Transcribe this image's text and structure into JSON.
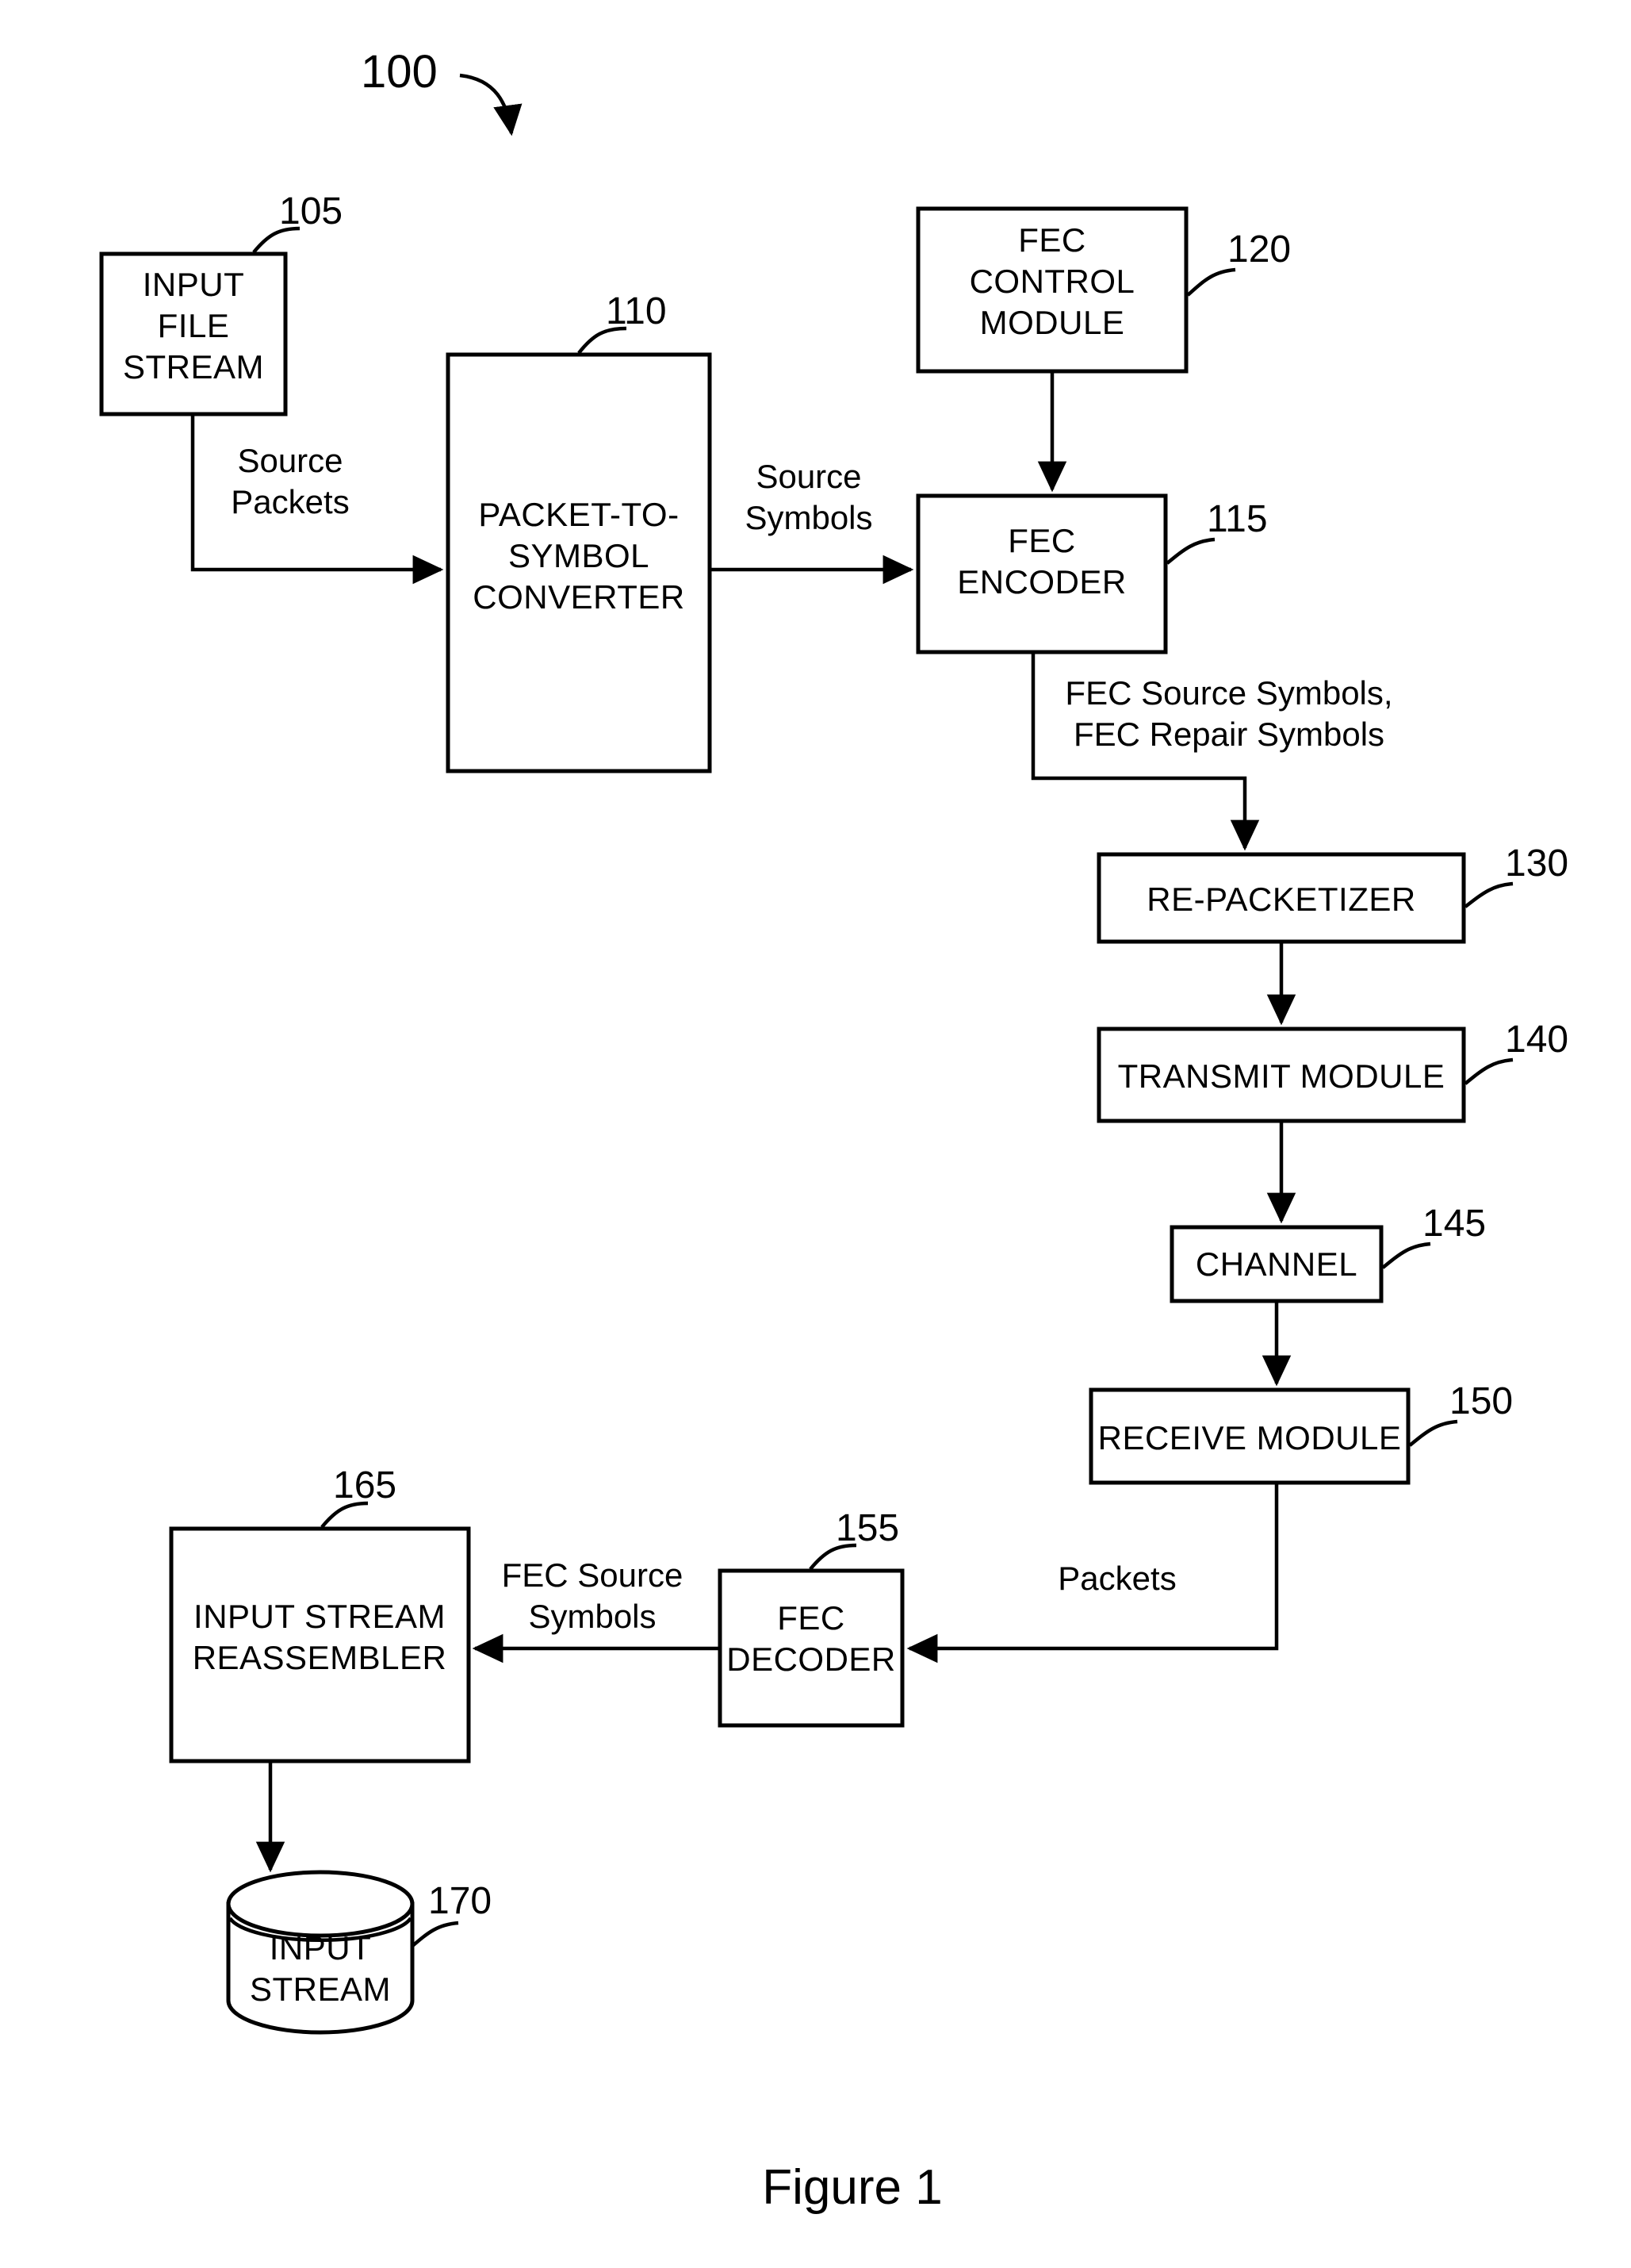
{
  "figure": {
    "caption": "Figure 1",
    "system_ref": "100"
  },
  "blocks": [
    {
      "id": "input-file-stream",
      "ref": "105",
      "lines": [
        "INPUT",
        "FILE",
        "STREAM"
      ]
    },
    {
      "id": "packet-to-symbol-converter",
      "ref": "110",
      "lines": [
        "PACKET-TO-",
        "SYMBOL",
        "CONVERTER"
      ]
    },
    {
      "id": "fec-control-module",
      "ref": "120",
      "lines": [
        "FEC",
        "CONTROL",
        "MODULE"
      ]
    },
    {
      "id": "fec-encoder",
      "ref": "115",
      "lines": [
        "FEC",
        "ENCODER"
      ]
    },
    {
      "id": "re-packetizer",
      "ref": "130",
      "lines": [
        "RE-PACKETIZER"
      ]
    },
    {
      "id": "transmit-module",
      "ref": "140",
      "lines": [
        "TRANSMIT MODULE"
      ]
    },
    {
      "id": "channel",
      "ref": "145",
      "lines": [
        "CHANNEL"
      ]
    },
    {
      "id": "receive-module",
      "ref": "150",
      "lines": [
        "RECEIVE MODULE"
      ]
    },
    {
      "id": "fec-decoder",
      "ref": "155",
      "lines": [
        "FEC",
        "DECODER"
      ]
    },
    {
      "id": "input-stream-reassembler",
      "ref": "165",
      "lines": [
        "INPUT STREAM",
        "REASSEMBLER"
      ]
    },
    {
      "id": "input-stream-store",
      "ref": "170",
      "lines": [
        "INPUT",
        "STREAM"
      ]
    }
  ],
  "edges": [
    {
      "id": "source-packets",
      "lines": [
        "Source",
        "Packets"
      ]
    },
    {
      "id": "source-symbols",
      "lines": [
        "Source",
        "Symbols"
      ]
    },
    {
      "id": "fec-symbols-out",
      "lines": [
        "FEC Source Symbols,",
        "FEC Repair Symbols"
      ]
    },
    {
      "id": "packets",
      "lines": [
        "Packets"
      ]
    },
    {
      "id": "fec-source-symbols-in",
      "lines": [
        "FEC Source",
        "Symbols"
      ]
    }
  ],
  "colors": {
    "ink": "#000000",
    "paper": "#ffffff"
  }
}
